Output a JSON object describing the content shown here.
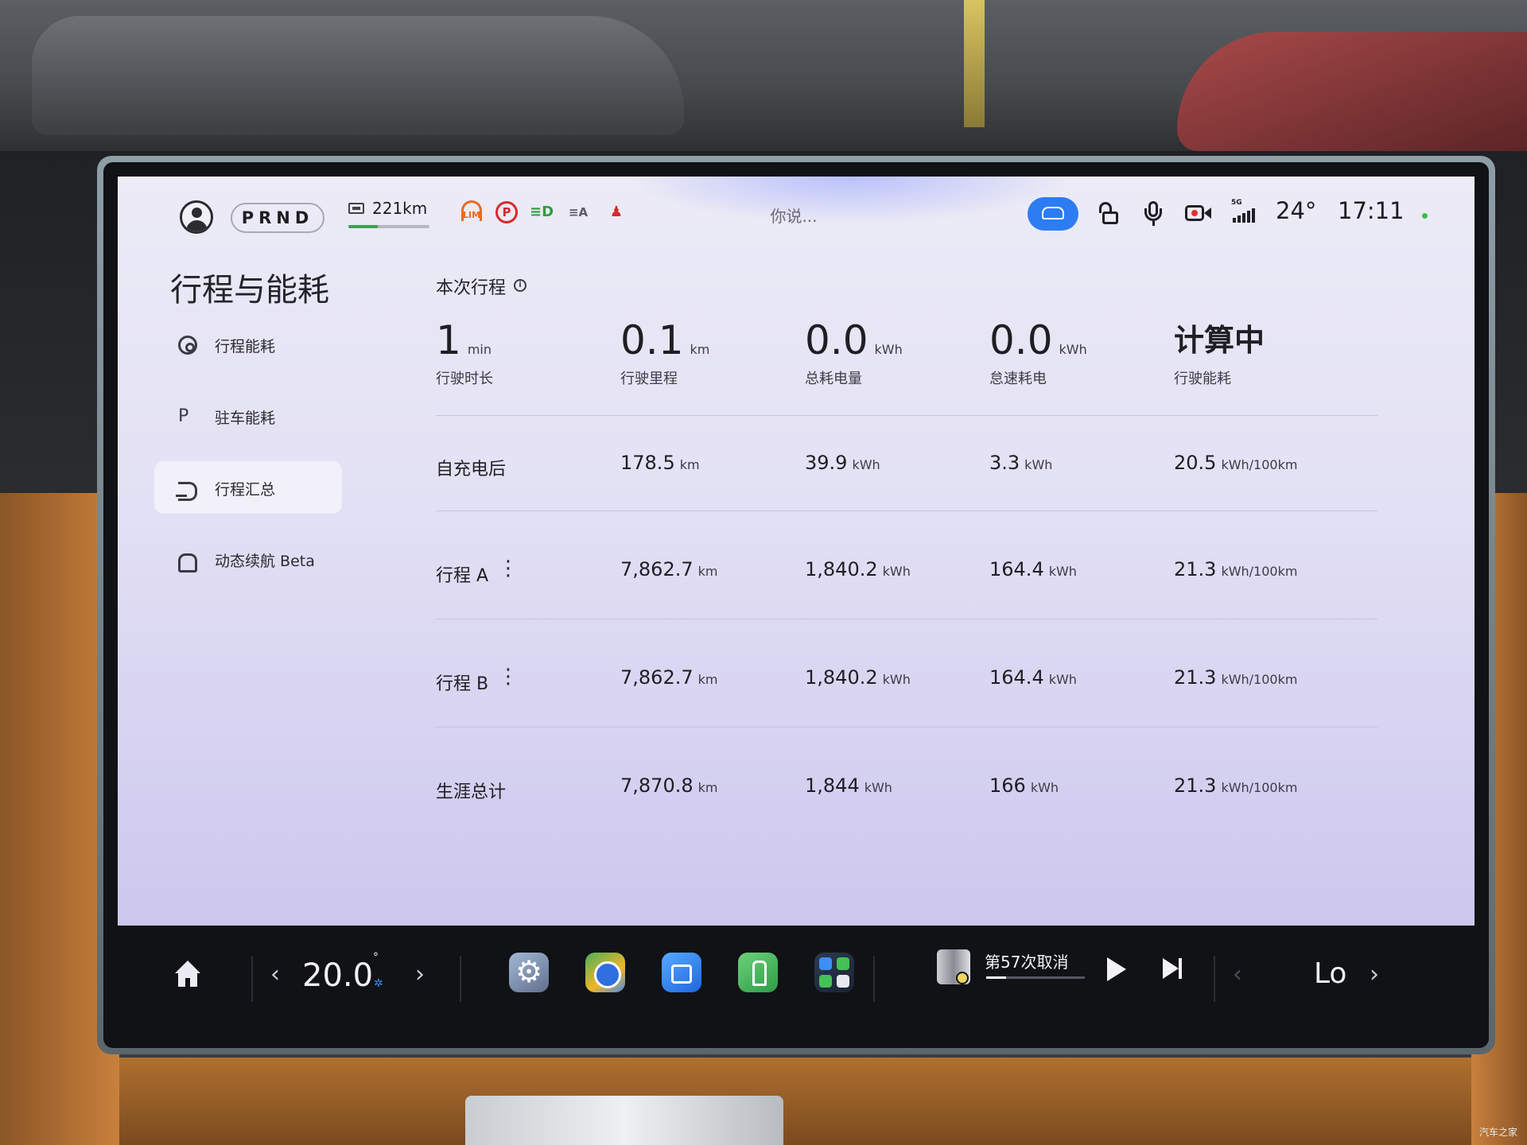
{
  "status_bar": {
    "gear": "PRND",
    "range_text": "221km",
    "range_fraction": 0.36,
    "tell_lim": "LIM",
    "voice_placeholder": "你说...",
    "temperature": "24°",
    "time": "17:11",
    "network": "5G"
  },
  "sidebar": {
    "title": "行程与能耗",
    "items": [
      {
        "label": "行程能耗",
        "icon": "steering-wheel-icon",
        "active": false
      },
      {
        "label": "驻车能耗",
        "icon": "parking-icon",
        "active": false
      },
      {
        "label": "行程汇总",
        "icon": "route-icon",
        "active": true
      },
      {
        "label": "动态续航 Beta",
        "icon": "car-range-icon",
        "active": false
      }
    ]
  },
  "current_trip": {
    "title": "本次行程",
    "metrics": [
      {
        "value": "1",
        "unit": "min",
        "label": "行驶时长"
      },
      {
        "value": "0.1",
        "unit": "km",
        "label": "行驶里程"
      },
      {
        "value": "0.0",
        "unit": "kWh",
        "label": "总耗电量"
      },
      {
        "value": "0.0",
        "unit": "kWh",
        "label": "怠速耗电"
      },
      {
        "value": "计算中",
        "unit": "",
        "label": "行驶能耗"
      }
    ]
  },
  "summary_rows": [
    {
      "name": "自充电后",
      "distance": "178.5",
      "distance_unit": "km",
      "energy": "39.9",
      "energy_unit": "kWh",
      "idle": "3.3",
      "idle_unit": "kWh",
      "consumption": "20.5",
      "consumption_unit": "kWh/100km",
      "menu": ""
    },
    {
      "name": "行程 A",
      "distance": "7,862.7",
      "distance_unit": "km",
      "energy": "1,840.2",
      "energy_unit": "kWh",
      "idle": "164.4",
      "idle_unit": "kWh",
      "consumption": "21.3",
      "consumption_unit": "kWh/100km",
      "menu": "⋮"
    },
    {
      "name": "行程 B",
      "distance": "7,862.7",
      "distance_unit": "km",
      "energy": "1,840.2",
      "energy_unit": "kWh",
      "idle": "164.4",
      "idle_unit": "kWh",
      "consumption": "21.3",
      "consumption_unit": "kWh/100km",
      "menu": "⋮"
    },
    {
      "name": "生涯总计",
      "distance": "7,870.8",
      "distance_unit": "km",
      "energy": "1,844",
      "energy_unit": "kWh",
      "idle": "166",
      "idle_unit": "kWh",
      "consumption": "21.3",
      "consumption_unit": "kWh/100km",
      "menu": ""
    }
  ],
  "dock": {
    "climate_temp": "20.0",
    "climate_unit": "°",
    "apps": [
      "settings-app-icon",
      "navigation-app-icon",
      "video-call-app-icon",
      "seat-app-icon",
      "app-grid-icon"
    ],
    "media_title": "第57次取消",
    "media_progress": 0.2,
    "fan_level": "Lo"
  },
  "watermark": "汽车之家",
  "colors": {
    "accent": "#2e7cf2",
    "range_bar": "#3ea24f",
    "warning_red": "#d62a2a",
    "warning_orange": "#e76b1e",
    "headlight_green": "#2e9c3e"
  }
}
